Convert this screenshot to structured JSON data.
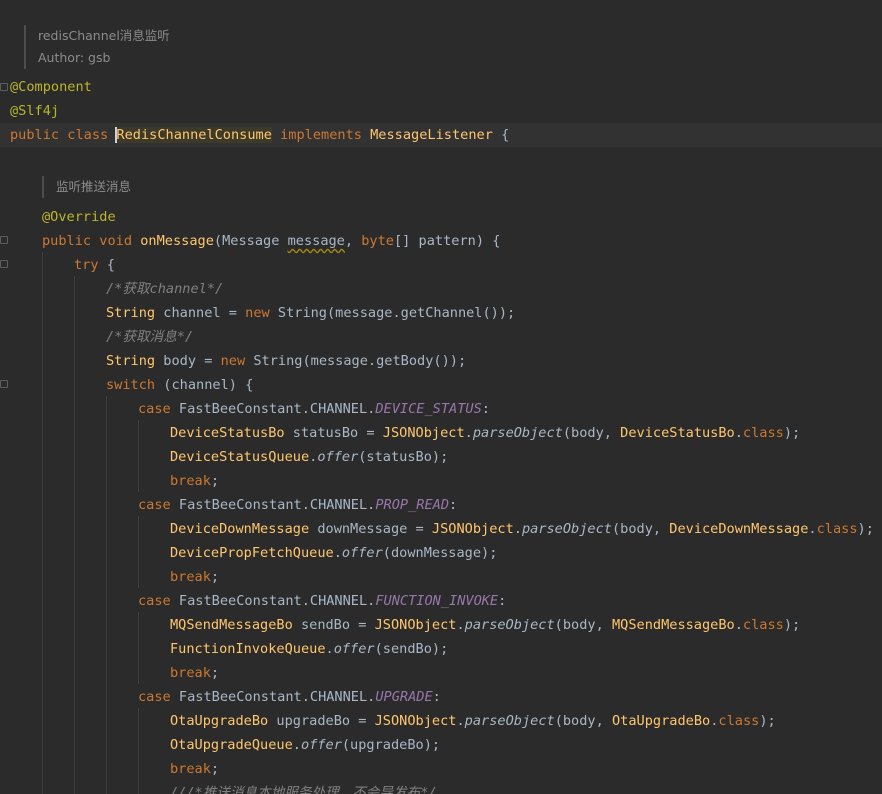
{
  "class_doc": {
    "line1": "redisChannel消息监听",
    "line2": "Author: gsb"
  },
  "method_doc": {
    "line1": "监听推送消息"
  },
  "code": {
    "ann_component": "@Component",
    "ann_slf4j": "@Slf4j",
    "cls_public": "public",
    "cls_class": "class",
    "cls_name": "RedisChannelConsume",
    "cls_implements": "implements",
    "cls_iface": "MessageListener",
    "cls_brace": " {",
    "ann_override": "@Override",
    "m_public": "public",
    "m_void": "void",
    "m_name": "onMessage",
    "m_open": "(Message ",
    "m_param": "message",
    "m_mid": ", ",
    "m_byte": "byte",
    "m_rest": "[] pattern) {",
    "try_kw": "try",
    "try_brace": " {",
    "c1": "/*获取channel*/",
    "ch_type": "String",
    "ch_mid": " channel = ",
    "ch_new": "new",
    "ch_rest": " String(message.getChannel());",
    "c2": "/*获取消息*/",
    "b_type": "String",
    "b_mid": " body = ",
    "b_new": "new",
    "b_rest": " String(message.getBody());",
    "sw_kw": "switch",
    "sw_rest": " (channel) {",
    "case1_kw": "case",
    "case1_pre": " FastBeeConstant.CHANNEL.",
    "case1_field": "DEVICE_STATUS",
    "case1_colon": ":",
    "l1_type": "DeviceStatusBo",
    "l1_mid": " statusBo = ",
    "l1_cls": "JSONObject",
    "l1_dot": ".",
    "l1_fn": "parseObject",
    "l1_args": "(body, ",
    "l1_arg2": "DeviceStatusBo",
    "l1_dot2": ".",
    "l1_class": "class",
    "l1_end": ");",
    "l2_type": "DeviceStatusQueue",
    "l2_dot": ".",
    "l2_fn": "offer",
    "l2_rest": "(statusBo);",
    "brk": "break",
    "semi": ";",
    "case2_kw": "case",
    "case2_pre": " FastBeeConstant.CHANNEL.",
    "case2_field": "PROP_READ",
    "case2_colon": ":",
    "l3_type": "DeviceDownMessage",
    "l3_mid": " downMessage = ",
    "l3_cls": "JSONObject",
    "l3_dot": ".",
    "l3_fn": "parseObject",
    "l3_args": "(body, ",
    "l3_arg2": "DeviceDownMessage",
    "l3_dot2": ".",
    "l3_class": "class",
    "l3_end": ");",
    "l4_type": "DevicePropFetchQueue",
    "l4_dot": ".",
    "l4_fn": "offer",
    "l4_rest": "(downMessage);",
    "case3_kw": "case",
    "case3_pre": " FastBeeConstant.CHANNEL.",
    "case3_field": "FUNCTION_INVOKE",
    "case3_colon": ":",
    "l5_type": "MQSendMessageBo",
    "l5_mid": " sendBo = ",
    "l5_cls": "JSONObject",
    "l5_dot": ".",
    "l5_fn": "parseObject",
    "l5_args": "(body, ",
    "l5_arg2": "MQSendMessageBo",
    "l5_dot2": ".",
    "l5_class": "class",
    "l5_end": ");",
    "l6_type": "FunctionInvokeQueue",
    "l6_dot": ".",
    "l6_fn": "offer",
    "l6_rest": "(sendBo);",
    "case4_kw": "case",
    "case4_pre": " FastBeeConstant.CHANNEL.",
    "case4_field": "UPGRADE",
    "case4_colon": ":",
    "l7_type": "OtaUpgradeBo",
    "l7_mid": " upgradeBo = ",
    "l7_cls": "JSONObject",
    "l7_dot": ".",
    "l7_fn": "parseObject",
    "l7_args": "(body, ",
    "l7_arg2": "OtaUpgradeBo",
    "l7_dot2": ".",
    "l7_class": "class",
    "l7_end": ");",
    "l8_type": "OtaUpgradeQueue",
    "l8_dot": ".",
    "l8_fn": "offer",
    "l8_rest": "(upgradeBo);",
    "c3": "///*推送消息本地服务处理，不会导发布*/"
  }
}
